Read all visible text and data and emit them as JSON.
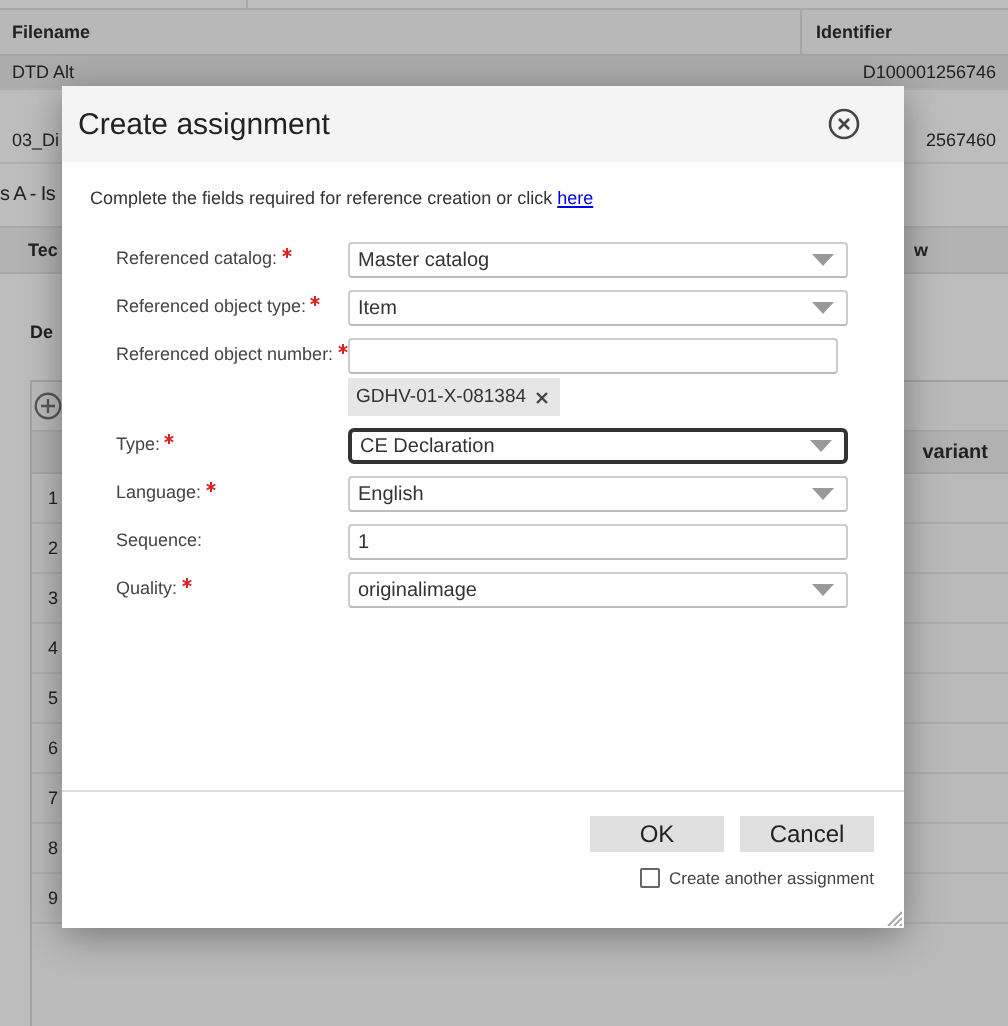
{
  "background": {
    "columns": [
      "Filename",
      "Identifier"
    ],
    "rows": [
      {
        "filename": "DTD Alt",
        "identifier": "D100001256746",
        "selected": true
      },
      {
        "filename": "03_Di",
        "identifier": "2567460",
        "selected": false
      }
    ],
    "heading": "s A - Is",
    "tabs": [
      "Tec",
      "w"
    ],
    "section_label": "De",
    "table": {
      "column_header": "variant",
      "row_numbers": [
        "1",
        "2",
        "3",
        "4",
        "5",
        "6",
        "7",
        "8",
        "9"
      ]
    }
  },
  "dialog": {
    "title": "Create assignment",
    "intro": {
      "text": "Complete the fields required for reference creation or click ",
      "link": "here"
    },
    "fields": [
      {
        "kind": "select",
        "label": "Referenced catalog:",
        "required": true,
        "value": "Master catalog",
        "focused": false
      },
      {
        "kind": "select",
        "label": "Referenced object type:",
        "required": true,
        "value": "Item",
        "focused": false
      },
      {
        "kind": "tags",
        "label": "Referenced object number:",
        "required": true,
        "tags": [
          "GDHV-01-X-081384"
        ],
        "focused": false
      },
      {
        "kind": "select",
        "label": "Type:",
        "required": true,
        "value": "CE Declaration",
        "focused": true
      },
      {
        "kind": "select",
        "label": "Language:",
        "required": true,
        "value": "English",
        "focused": false
      },
      {
        "kind": "text",
        "label": "Sequence:",
        "required": false,
        "value": "1",
        "focused": false
      },
      {
        "kind": "select",
        "label": "Quality:",
        "required": true,
        "value": "originalimage",
        "focused": false
      }
    ],
    "buttons": [
      "OK",
      "Cancel"
    ],
    "checkbox": {
      "label": "Create another assignment",
      "checked": false
    }
  }
}
